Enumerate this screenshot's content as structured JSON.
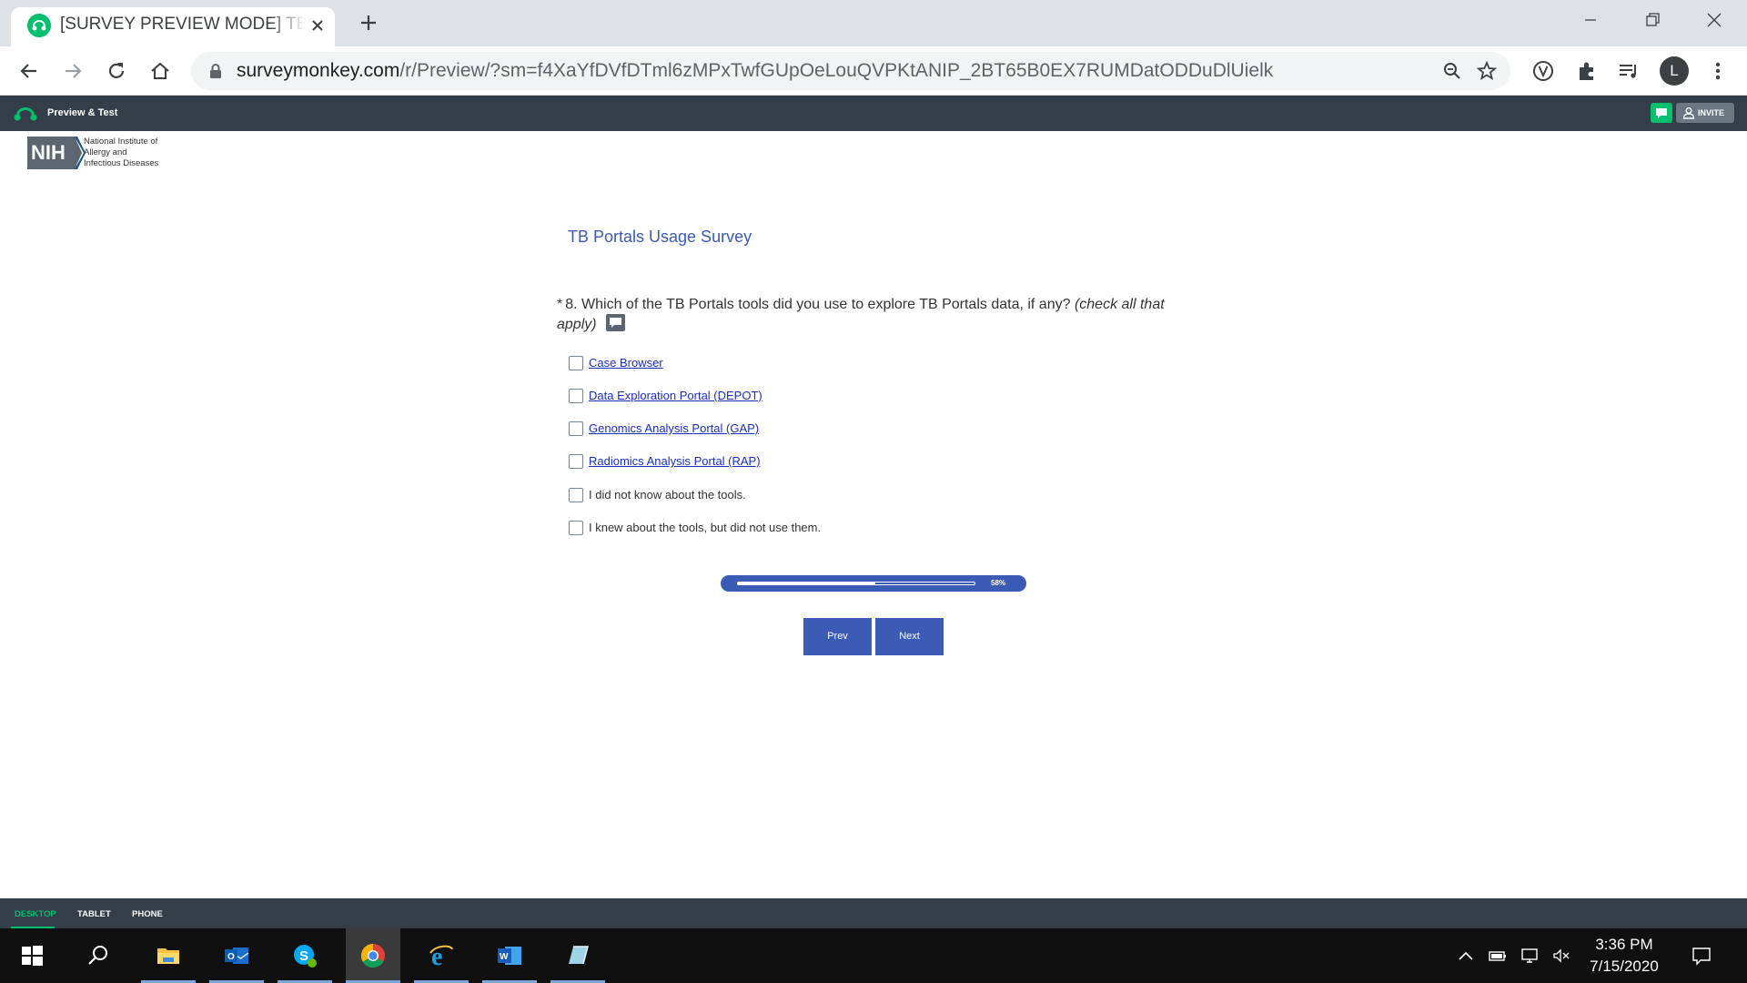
{
  "browser": {
    "tab_title": "[SURVEY PREVIEW MODE] TB Portals Usage Survey",
    "url_host": "surveymonkey.com",
    "url_path": "/r/Preview/?sm=f4XaYfDVfDTml6zMPxTwfGUpOeLouQVPKtANIP_2BT65B0EX7RUMDatODDuDlUielk",
    "profile_initial": "L"
  },
  "sm_header": {
    "title": "Preview & Test",
    "invite_label": "INVITE"
  },
  "logo": {
    "abbrev": "NIH",
    "line1": "National Institute of",
    "line2": "Allergy and",
    "line3": "Infectious Diseases"
  },
  "survey": {
    "title": "TB Portals Usage Survey",
    "question": {
      "required_mark": "*",
      "text": "8. Which of the TB Portals tools did you use to explore TB Portals data, if any?",
      "hint": "(check all that apply)"
    },
    "options": [
      {
        "label": "Case Browser",
        "is_link": true,
        "checked": false
      },
      {
        "label": "Data Exploration Portal (DEPOT)",
        "is_link": true,
        "checked": false
      },
      {
        "label": "Genomics Analysis Portal (GAP)",
        "is_link": true,
        "checked": false
      },
      {
        "label": "Radiomics Analysis Portal (RAP)",
        "is_link": true,
        "checked": false
      },
      {
        "label": "I did not know about the tools.",
        "is_link": false,
        "checked": false
      },
      {
        "label": "I knew about the tools, but did not use them.",
        "is_link": false,
        "checked": false
      }
    ],
    "progress": {
      "value": 0.58,
      "label": "58%"
    },
    "prev_label": "Prev",
    "next_label": "Next"
  },
  "device_tabs": {
    "desktop": "DESKTOP",
    "tablet": "TABLET",
    "phone": "PHONE",
    "active": "desktop"
  },
  "taskbar": {
    "time": "3:36 PM",
    "date": "7/15/2020",
    "apps": [
      "windows-start",
      "search",
      "file-explorer",
      "outlook",
      "skype",
      "chrome",
      "internet-explorer",
      "word",
      "other-app"
    ]
  },
  "colors": {
    "accent_blue": "#3b5bb5",
    "sm_green": "#00bf6f",
    "sm_dark": "#333e48",
    "link_blue": "#1b2ec2"
  }
}
